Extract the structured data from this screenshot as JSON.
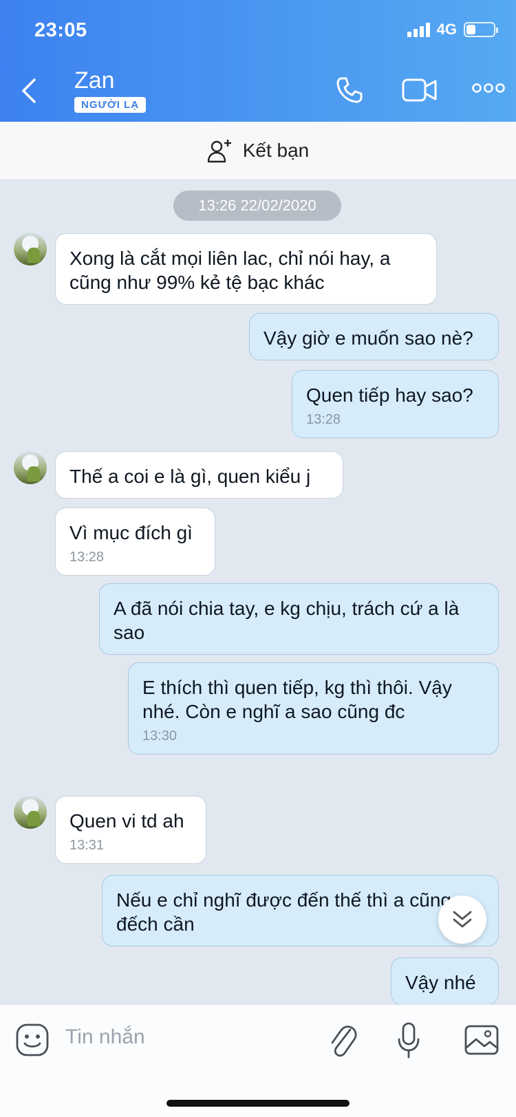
{
  "status_bar": {
    "time": "23:05",
    "network": "4G",
    "battery_percent": 35
  },
  "header": {
    "contact_name": "Zan",
    "badge": "NGƯỜI LẠ",
    "icons": [
      "back-icon",
      "phone-icon",
      "video-call-icon",
      "more-icon"
    ]
  },
  "friend_bar": {
    "label": "Kết bạn",
    "icon": "add-friend-icon"
  },
  "chat": {
    "timestamp": "13:26 22/02/2020",
    "messages": [
      {
        "from": "them",
        "text": "Xong là cắt mọi liên lac, chỉ nói hay, a cũng như 99% kẻ tệ bạc khác",
        "time": ""
      },
      {
        "from": "me",
        "text": "Vậy giờ e muốn sao nè?",
        "time": ""
      },
      {
        "from": "me",
        "text": "Quen tiếp hay sao?",
        "time": "13:28"
      },
      {
        "from": "them",
        "text": "Thế a coi e là gì, quen kiểu j",
        "time": ""
      },
      {
        "from": "them",
        "text": "Vì mục đích gì",
        "time": "13:28"
      },
      {
        "from": "me",
        "text": "  A đã nói chia tay, e kg chịu, trách cứ a là sao",
        "time": ""
      },
      {
        "from": "me",
        "text": "E thích thì quen tiếp, kg thì thôi. Vậy nhé. Còn e nghĩ a sao cũng đc",
        "time": "13:30"
      },
      {
        "from": "them",
        "text": "Quen vi td ah",
        "time": "13:31"
      },
      {
        "from": "me",
        "text": "Nếu e chỉ nghĩ được đến thế thì a cũng đếch cần",
        "time": ""
      },
      {
        "from": "me",
        "text": "Vậy nhé",
        "time": ""
      }
    ]
  },
  "input": {
    "placeholder": "Tin nhắn",
    "icons": [
      "sticker-icon",
      "attachment-icon",
      "microphone-icon",
      "image-icon"
    ]
  },
  "colors": {
    "header_start": "#3d82f0",
    "header_end": "#56a9f2",
    "outgoing_bubble": "#d6ecfb",
    "incoming_bubble": "#ffffff",
    "chat_bg": "#e2e8f0"
  }
}
